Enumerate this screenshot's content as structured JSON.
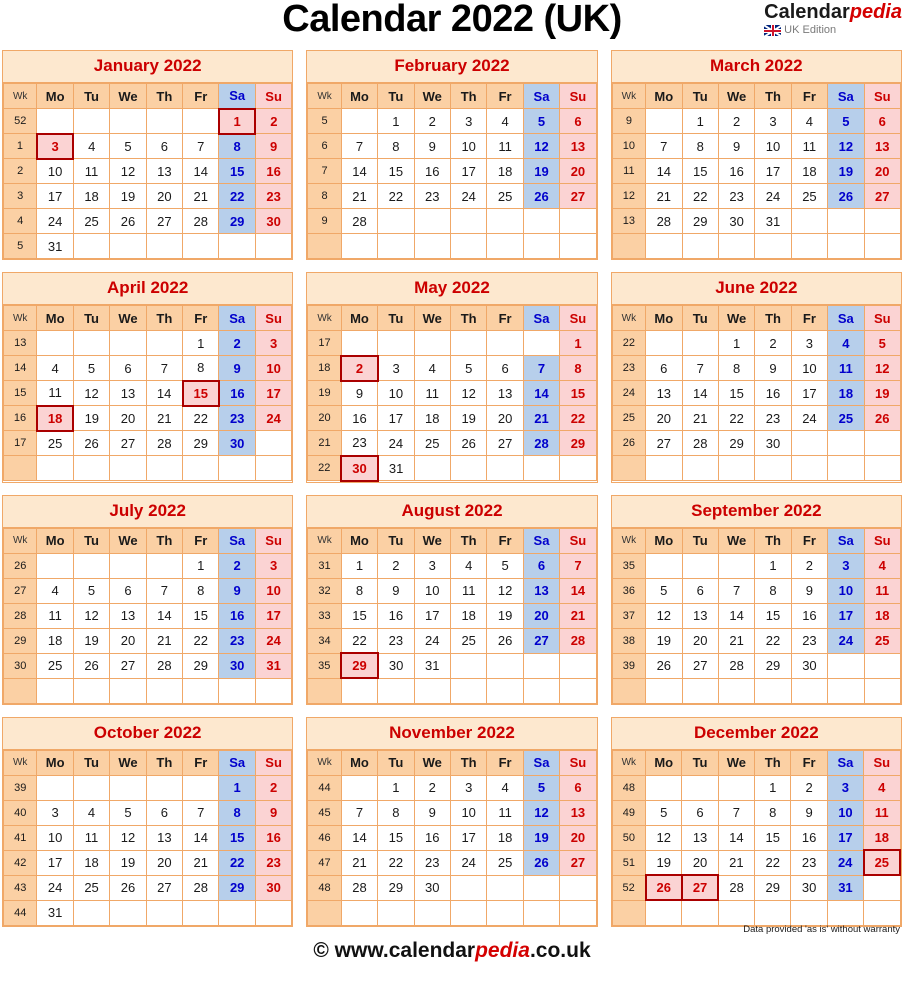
{
  "header": {
    "title": "Calendar 2022 (UK)",
    "brand_calendar": "Calendar",
    "brand_pedia": "pedia",
    "brand_edition": "UK Edition",
    "flag_icon": "uk-flag-icon"
  },
  "colors": {
    "title_red": "#cc0000",
    "saturday_blue": "#0000cc",
    "sunday_red": "#cc0000",
    "header_orange": "#fbd0a4",
    "month_title_bg": "#fde8cf",
    "saturday_bg": "#b7cfeb",
    "sunday_bg": "#fbd3d3",
    "border": "#f0a868",
    "holiday_border": "#aa0000"
  },
  "weekday_headers": [
    "Wk",
    "Mo",
    "Tu",
    "We",
    "Th",
    "Fr",
    "Sa",
    "Su"
  ],
  "footer": {
    "copyright_prefix": "© www.calendar",
    "copyright_pedia": "pedia",
    "copyright_suffix": ".co.uk",
    "disclaimer": "Data provided 'as is' without warranty"
  },
  "months": [
    {
      "name": "January 2022",
      "weeks": [
        {
          "wk": "52",
          "days": [
            "",
            "",
            "",
            "",
            "",
            "1",
            "2"
          ],
          "holidays": [
            5
          ]
        },
        {
          "wk": "1",
          "days": [
            "3",
            "4",
            "5",
            "6",
            "7",
            "8",
            "9"
          ],
          "holidays": [
            0
          ]
        },
        {
          "wk": "2",
          "days": [
            "10",
            "11",
            "12",
            "13",
            "14",
            "15",
            "16"
          ],
          "holidays": []
        },
        {
          "wk": "3",
          "days": [
            "17",
            "18",
            "19",
            "20",
            "21",
            "22",
            "23"
          ],
          "holidays": []
        },
        {
          "wk": "4",
          "days": [
            "24",
            "25",
            "26",
            "27",
            "28",
            "29",
            "30"
          ],
          "holidays": []
        },
        {
          "wk": "5",
          "days": [
            "31",
            "",
            "",
            "",
            "",
            "",
            ""
          ],
          "holidays": []
        }
      ]
    },
    {
      "name": "February 2022",
      "weeks": [
        {
          "wk": "5",
          "days": [
            "",
            "1",
            "2",
            "3",
            "4",
            "5",
            "6"
          ],
          "holidays": []
        },
        {
          "wk": "6",
          "days": [
            "7",
            "8",
            "9",
            "10",
            "11",
            "12",
            "13"
          ],
          "holidays": []
        },
        {
          "wk": "7",
          "days": [
            "14",
            "15",
            "16",
            "17",
            "18",
            "19",
            "20"
          ],
          "holidays": []
        },
        {
          "wk": "8",
          "days": [
            "21",
            "22",
            "23",
            "24",
            "25",
            "26",
            "27"
          ],
          "holidays": []
        },
        {
          "wk": "9",
          "days": [
            "28",
            "",
            "",
            "",
            "",
            "",
            ""
          ],
          "holidays": []
        },
        {
          "wk": "",
          "days": [
            "",
            "",
            "",
            "",
            "",
            "",
            ""
          ],
          "holidays": []
        }
      ]
    },
    {
      "name": "March 2022",
      "weeks": [
        {
          "wk": "9",
          "days": [
            "",
            "1",
            "2",
            "3",
            "4",
            "5",
            "6"
          ],
          "holidays": []
        },
        {
          "wk": "10",
          "days": [
            "7",
            "8",
            "9",
            "10",
            "11",
            "12",
            "13"
          ],
          "holidays": []
        },
        {
          "wk": "11",
          "days": [
            "14",
            "15",
            "16",
            "17",
            "18",
            "19",
            "20"
          ],
          "holidays": []
        },
        {
          "wk": "12",
          "days": [
            "21",
            "22",
            "23",
            "24",
            "25",
            "26",
            "27"
          ],
          "holidays": []
        },
        {
          "wk": "13",
          "days": [
            "28",
            "29",
            "30",
            "31",
            "",
            "",
            ""
          ],
          "holidays": []
        },
        {
          "wk": "",
          "days": [
            "",
            "",
            "",
            "",
            "",
            "",
            ""
          ],
          "holidays": []
        }
      ]
    },
    {
      "name": "April 2022",
      "weeks": [
        {
          "wk": "13",
          "days": [
            "",
            "",
            "",
            "",
            "1",
            "2",
            "3"
          ],
          "holidays": []
        },
        {
          "wk": "14",
          "days": [
            "4",
            "5",
            "6",
            "7",
            "8",
            "9",
            "10"
          ],
          "holidays": []
        },
        {
          "wk": "15",
          "days": [
            "11",
            "12",
            "13",
            "14",
            "15",
            "16",
            "17"
          ],
          "holidays": [
            4
          ]
        },
        {
          "wk": "16",
          "days": [
            "18",
            "19",
            "20",
            "21",
            "22",
            "23",
            "24"
          ],
          "holidays": [
            0
          ]
        },
        {
          "wk": "17",
          "days": [
            "25",
            "26",
            "27",
            "28",
            "29",
            "30",
            ""
          ],
          "holidays": []
        },
        {
          "wk": "",
          "days": [
            "",
            "",
            "",
            "",
            "",
            "",
            ""
          ],
          "holidays": []
        }
      ]
    },
    {
      "name": "May 2022",
      "weeks": [
        {
          "wk": "17",
          "days": [
            "",
            "",
            "",
            "",
            "",
            "",
            "1"
          ],
          "holidays": []
        },
        {
          "wk": "18",
          "days": [
            "2",
            "3",
            "4",
            "5",
            "6",
            "7",
            "8"
          ],
          "holidays": [
            0
          ]
        },
        {
          "wk": "19",
          "days": [
            "9",
            "10",
            "11",
            "12",
            "13",
            "14",
            "15"
          ],
          "holidays": []
        },
        {
          "wk": "20",
          "days": [
            "16",
            "17",
            "18",
            "19",
            "20",
            "21",
            "22"
          ],
          "holidays": []
        },
        {
          "wk": "21",
          "days": [
            "23",
            "24",
            "25",
            "26",
            "27",
            "28",
            "29"
          ],
          "holidays": []
        },
        {
          "wk": "22",
          "days": [
            "30",
            "31",
            "",
            "",
            "",
            "",
            ""
          ],
          "holidays": [
            0
          ]
        }
      ]
    },
    {
      "name": "June 2022",
      "weeks": [
        {
          "wk": "22",
          "days": [
            "",
            "",
            "1",
            "2",
            "3",
            "4",
            "5"
          ],
          "holidays": []
        },
        {
          "wk": "23",
          "days": [
            "6",
            "7",
            "8",
            "9",
            "10",
            "11",
            "12"
          ],
          "holidays": []
        },
        {
          "wk": "24",
          "days": [
            "13",
            "14",
            "15",
            "16",
            "17",
            "18",
            "19"
          ],
          "holidays": []
        },
        {
          "wk": "25",
          "days": [
            "20",
            "21",
            "22",
            "23",
            "24",
            "25",
            "26"
          ],
          "holidays": []
        },
        {
          "wk": "26",
          "days": [
            "27",
            "28",
            "29",
            "30",
            "",
            "",
            ""
          ],
          "holidays": []
        },
        {
          "wk": "",
          "days": [
            "",
            "",
            "",
            "",
            "",
            "",
            ""
          ],
          "holidays": []
        }
      ]
    },
    {
      "name": "July 2022",
      "weeks": [
        {
          "wk": "26",
          "days": [
            "",
            "",
            "",
            "",
            "1",
            "2",
            "3"
          ],
          "holidays": []
        },
        {
          "wk": "27",
          "days": [
            "4",
            "5",
            "6",
            "7",
            "8",
            "9",
            "10"
          ],
          "holidays": []
        },
        {
          "wk": "28",
          "days": [
            "11",
            "12",
            "13",
            "14",
            "15",
            "16",
            "17"
          ],
          "holidays": []
        },
        {
          "wk": "29",
          "days": [
            "18",
            "19",
            "20",
            "21",
            "22",
            "23",
            "24"
          ],
          "holidays": []
        },
        {
          "wk": "30",
          "days": [
            "25",
            "26",
            "27",
            "28",
            "29",
            "30",
            "31"
          ],
          "holidays": []
        },
        {
          "wk": "",
          "days": [
            "",
            "",
            "",
            "",
            "",
            "",
            ""
          ],
          "holidays": []
        }
      ]
    },
    {
      "name": "August 2022",
      "weeks": [
        {
          "wk": "31",
          "days": [
            "1",
            "2",
            "3",
            "4",
            "5",
            "6",
            "7"
          ],
          "holidays": []
        },
        {
          "wk": "32",
          "days": [
            "8",
            "9",
            "10",
            "11",
            "12",
            "13",
            "14"
          ],
          "holidays": []
        },
        {
          "wk": "33",
          "days": [
            "15",
            "16",
            "17",
            "18",
            "19",
            "20",
            "21"
          ],
          "holidays": []
        },
        {
          "wk": "34",
          "days": [
            "22",
            "23",
            "24",
            "25",
            "26",
            "27",
            "28"
          ],
          "holidays": []
        },
        {
          "wk": "35",
          "days": [
            "29",
            "30",
            "31",
            "",
            "",
            "",
            ""
          ],
          "holidays": [
            0
          ]
        },
        {
          "wk": "",
          "days": [
            "",
            "",
            "",
            "",
            "",
            "",
            ""
          ],
          "holidays": []
        }
      ]
    },
    {
      "name": "September 2022",
      "weeks": [
        {
          "wk": "35",
          "days": [
            "",
            "",
            "",
            "1",
            "2",
            "3",
            "4"
          ],
          "holidays": []
        },
        {
          "wk": "36",
          "days": [
            "5",
            "6",
            "7",
            "8",
            "9",
            "10",
            "11"
          ],
          "holidays": []
        },
        {
          "wk": "37",
          "days": [
            "12",
            "13",
            "14",
            "15",
            "16",
            "17",
            "18"
          ],
          "holidays": []
        },
        {
          "wk": "38",
          "days": [
            "19",
            "20",
            "21",
            "22",
            "23",
            "24",
            "25"
          ],
          "holidays": []
        },
        {
          "wk": "39",
          "days": [
            "26",
            "27",
            "28",
            "29",
            "30",
            "",
            ""
          ],
          "holidays": []
        },
        {
          "wk": "",
          "days": [
            "",
            "",
            "",
            "",
            "",
            "",
            ""
          ],
          "holidays": []
        }
      ]
    },
    {
      "name": "October 2022",
      "weeks": [
        {
          "wk": "39",
          "days": [
            "",
            "",
            "",
            "",
            "",
            "1",
            "2"
          ],
          "holidays": []
        },
        {
          "wk": "40",
          "days": [
            "3",
            "4",
            "5",
            "6",
            "7",
            "8",
            "9"
          ],
          "holidays": []
        },
        {
          "wk": "41",
          "days": [
            "10",
            "11",
            "12",
            "13",
            "14",
            "15",
            "16"
          ],
          "holidays": []
        },
        {
          "wk": "42",
          "days": [
            "17",
            "18",
            "19",
            "20",
            "21",
            "22",
            "23"
          ],
          "holidays": []
        },
        {
          "wk": "43",
          "days": [
            "24",
            "25",
            "26",
            "27",
            "28",
            "29",
            "30"
          ],
          "holidays": []
        },
        {
          "wk": "44",
          "days": [
            "31",
            "",
            "",
            "",
            "",
            "",
            ""
          ],
          "holidays": []
        }
      ]
    },
    {
      "name": "November 2022",
      "weeks": [
        {
          "wk": "44",
          "days": [
            "",
            "1",
            "2",
            "3",
            "4",
            "5",
            "6"
          ],
          "holidays": []
        },
        {
          "wk": "45",
          "days": [
            "7",
            "8",
            "9",
            "10",
            "11",
            "12",
            "13"
          ],
          "holidays": []
        },
        {
          "wk": "46",
          "days": [
            "14",
            "15",
            "16",
            "17",
            "18",
            "19",
            "20"
          ],
          "holidays": []
        },
        {
          "wk": "47",
          "days": [
            "21",
            "22",
            "23",
            "24",
            "25",
            "26",
            "27"
          ],
          "holidays": []
        },
        {
          "wk": "48",
          "days": [
            "28",
            "29",
            "30",
            "",
            "",
            "",
            ""
          ],
          "holidays": []
        },
        {
          "wk": "",
          "days": [
            "",
            "",
            "",
            "",
            "",
            "",
            ""
          ],
          "holidays": []
        }
      ]
    },
    {
      "name": "December 2022",
      "weeks": [
        {
          "wk": "48",
          "days": [
            "",
            "",
            "",
            "1",
            "2",
            "3",
            "4"
          ],
          "holidays": []
        },
        {
          "wk": "49",
          "days": [
            "5",
            "6",
            "7",
            "8",
            "9",
            "10",
            "11"
          ],
          "holidays": []
        },
        {
          "wk": "50",
          "days": [
            "12",
            "13",
            "14",
            "15",
            "16",
            "17",
            "18"
          ],
          "holidays": []
        },
        {
          "wk": "51",
          "days": [
            "19",
            "20",
            "21",
            "22",
            "23",
            "24",
            "25"
          ],
          "holidays": [
            6
          ]
        },
        {
          "wk": "52",
          "days": [
            "26",
            "27",
            "28",
            "29",
            "30",
            "31",
            ""
          ],
          "holidays": [
            0,
            1
          ]
        },
        {
          "wk": "",
          "days": [
            "",
            "",
            "",
            "",
            "",
            "",
            ""
          ],
          "holidays": []
        }
      ]
    }
  ]
}
